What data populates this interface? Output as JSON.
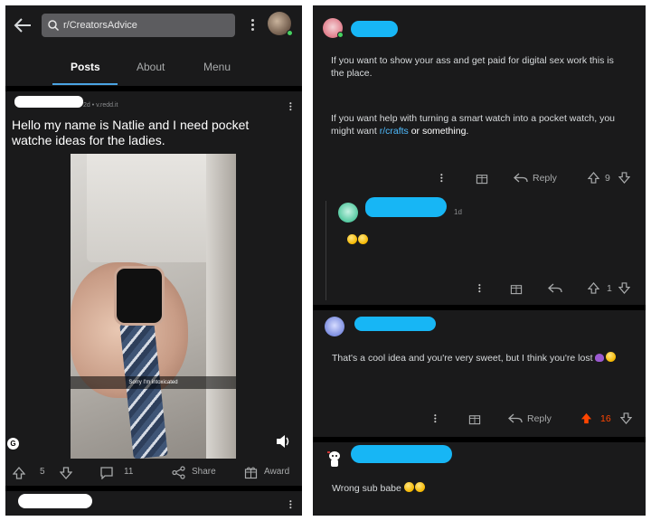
{
  "left": {
    "search": {
      "text": "r/CreatorsAdvice"
    },
    "tabs": [
      {
        "label": "Posts",
        "active": true
      },
      {
        "label": "About",
        "active": false
      },
      {
        "label": "Menu",
        "active": false
      }
    ],
    "post": {
      "meta": "2d • v.redd.it",
      "title": "Hello my name is Natlie and I need pocket watche ideas for the ladies.",
      "media": {
        "caption": "Sorry I'm intoxicated",
        "gif_badge": "G"
      },
      "votes": "5",
      "comments": "11",
      "share_label": "Share",
      "award_label": "Award"
    }
  },
  "right": {
    "comments": [
      {
        "paragraph1": "If you want to show your ass and get paid for digital sex work this is the place.",
        "paragraph2_prefix": "If you want help with turning a smart watch into a pocket watch, you might want ",
        "link": "r/crafts",
        "paragraph2_suffix": " or something.",
        "reply_label": "Reply",
        "votes": "9"
      },
      {
        "time": "1d",
        "votes": "1"
      },
      {
        "text": "That's a cool idea and you're very sweet, but I think you're lost",
        "reply_label": "Reply",
        "votes": "16"
      },
      {
        "text": "Wrong sub babe"
      }
    ]
  },
  "colors": {
    "background": "#1a1a1b",
    "accent_blue": "#4aa3e2",
    "upvote_orange": "#ff4500",
    "link_blue": "#4fbcff",
    "redaction_blue": "#17b6f5"
  },
  "icons": [
    "back-arrow-icon",
    "search-icon",
    "more-vertical-icon",
    "upvote-icon",
    "downvote-icon",
    "comment-icon",
    "share-icon",
    "award-icon",
    "reply-icon",
    "sound-icon",
    "gif-icon"
  ]
}
